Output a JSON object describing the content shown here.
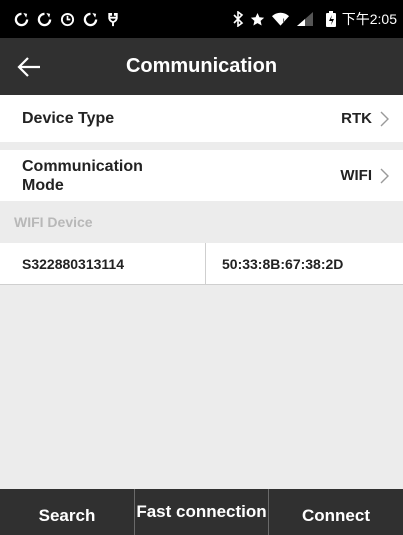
{
  "status_bar": {
    "time": "下午2:05",
    "icons": [
      "sync-icon",
      "sync-icon",
      "clock-icon",
      "sync-icon",
      "usb-icon",
      "bluetooth-icon",
      "star-icon",
      "wifi-icon",
      "signal-icon",
      "battery-icon"
    ]
  },
  "title_bar": {
    "title": "Communication",
    "back_icon": "arrow-left-icon"
  },
  "settings": {
    "device_type": {
      "label": "Device Type",
      "value": "RTK"
    },
    "communication_mode": {
      "label": "Communication Mode",
      "value": "WIFI"
    }
  },
  "wifi_section": {
    "label": "WIFI Device",
    "devices": [
      {
        "name": "S322880313114",
        "mac": "50:33:8B:67:38:2D"
      }
    ]
  },
  "actions": {
    "search": "Search",
    "fast_connection": "Fast connection",
    "connect": "Connect"
  },
  "colors": {
    "title_bar_bg": "#303030",
    "status_bar_bg": "#000000",
    "page_bg": "#ececec",
    "row_bg": "#ffffff",
    "section_label": "#b8b8b8"
  }
}
